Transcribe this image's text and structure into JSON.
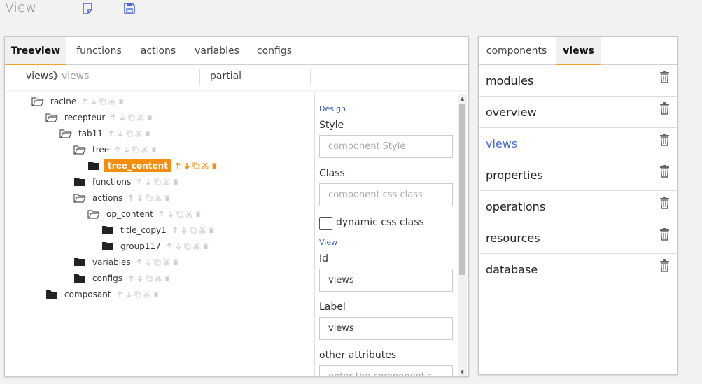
{
  "header": {
    "title": "View"
  },
  "left_tabs": [
    "Treeview",
    "functions",
    "actions",
    "variables",
    "configs"
  ],
  "breadcrumb": {
    "root": "views",
    "separator": "❯",
    "current": "views",
    "partial": "partial"
  },
  "tree": [
    {
      "label": "racine"
    },
    {
      "label": "recepteur"
    },
    {
      "label": "tab11"
    },
    {
      "label": "tree"
    },
    {
      "label": "tree_content"
    },
    {
      "label": "functions"
    },
    {
      "label": "actions"
    },
    {
      "label": "op_content"
    },
    {
      "label": "title_copy1"
    },
    {
      "label": "group117"
    },
    {
      "label": "variables"
    },
    {
      "label": "configs"
    },
    {
      "label": "composant"
    }
  ],
  "design": {
    "section_design": "Design",
    "style_label": "Style",
    "style_placeholder": "component Style",
    "class_label": "Class",
    "class_placeholder": "component css class",
    "dynamic_label": "dynamic css class",
    "section_view": "View",
    "id_label": "Id",
    "id_value": "views",
    "label_label": "Label",
    "label_value": "views",
    "other_label": "other attributes",
    "other_placeholder": "enter the component's"
  },
  "right_tabs": [
    "components",
    "views"
  ],
  "views_list": [
    "modules",
    "overview",
    "views",
    "properties",
    "operations",
    "resources",
    "database"
  ],
  "colors": {
    "accent": "#f4a22d",
    "selected": "#f58d0e",
    "link": "#4a68d6",
    "section": "#3a5fcd"
  },
  "icons": {
    "new": "new-document-icon",
    "save": "save-icon",
    "trash": "trash-icon"
  }
}
